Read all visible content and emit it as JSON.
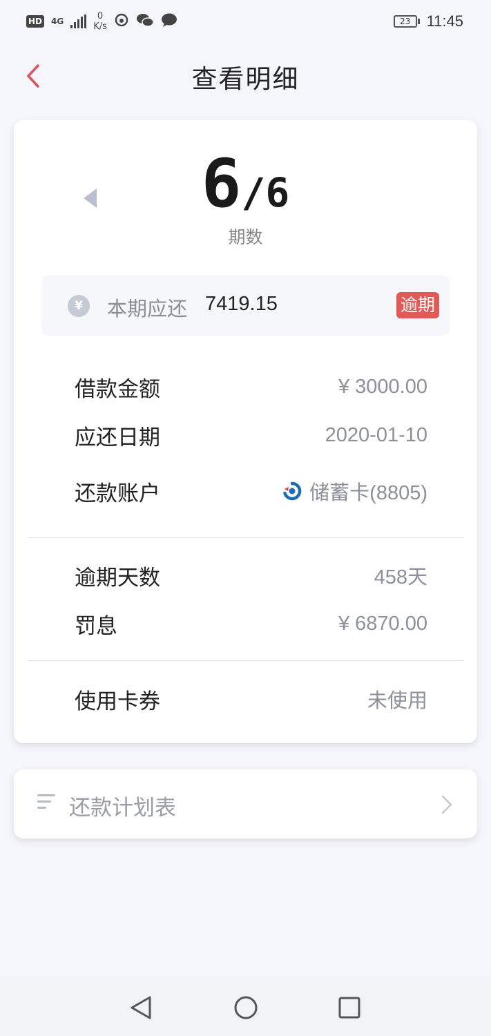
{
  "status_bar": {
    "hd": "HD",
    "network": "4G",
    "net_speed_value": "0",
    "net_speed_unit": "K/s",
    "battery": "23",
    "time": "11:45"
  },
  "header": {
    "title": "查看明细"
  },
  "period": {
    "current": "6",
    "total": "/6",
    "label": "期数"
  },
  "due": {
    "label": "本期应还",
    "amount": "7419.15",
    "badge": "逾期"
  },
  "details": {
    "loan_amount": {
      "label": "借款金额",
      "value": "¥ 3000.00"
    },
    "due_date": {
      "label": "应还日期",
      "value": "2020-01-10"
    },
    "account": {
      "label": "还款账户",
      "value": "储蓄卡(8805)"
    },
    "overdue_days": {
      "label": "逾期天数",
      "value": "458天"
    },
    "penalty": {
      "label": "罚息",
      "value": "¥ 6870.00"
    },
    "coupon": {
      "label": "使用卡券",
      "value": "未使用"
    }
  },
  "plan": {
    "label": "还款计划表"
  },
  "colors": {
    "accent_back": "#e0525d",
    "badge": "#e25a55",
    "bank_icon": "#1b6fb8"
  },
  "icons": [
    "back-icon",
    "prev-period-icon",
    "yen-icon",
    "bank-icon",
    "list-icon",
    "chevron-right-icon",
    "nav-back-icon",
    "nav-home-icon",
    "nav-recents-icon"
  ]
}
